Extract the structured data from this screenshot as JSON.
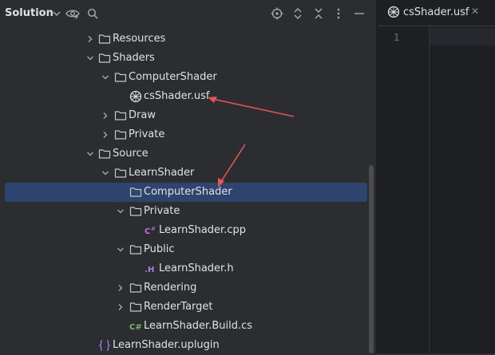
{
  "header": {
    "title": "Solution",
    "icons": [
      "chevron-down-icon",
      "eye-icon",
      "search-icon",
      "locate-icon",
      "expand-icon",
      "collapse-icon",
      "more-icon",
      "minimize-icon"
    ]
  },
  "tree": [
    {
      "label": "Resources",
      "icon": "folder",
      "expander": "collapsed"
    },
    {
      "label": "Shaders",
      "icon": "folder",
      "expander": "expanded"
    },
    {
      "label": "ComputerShader",
      "icon": "folder",
      "expander": "expanded"
    },
    {
      "label": "csShader.usf",
      "icon": "shader-file",
      "expander": "none"
    },
    {
      "label": "Draw",
      "icon": "folder",
      "expander": "collapsed"
    },
    {
      "label": "Private",
      "icon": "folder",
      "expander": "collapsed"
    },
    {
      "label": "Source",
      "icon": "folder",
      "expander": "expanded"
    },
    {
      "label": "LearnShader",
      "icon": "folder",
      "expander": "expanded"
    },
    {
      "label": "ComputerShader",
      "icon": "folder",
      "expander": "none",
      "selected": true
    },
    {
      "label": "Private",
      "icon": "folder",
      "expander": "expanded"
    },
    {
      "label": "LearnShader.cpp",
      "icon": "cpp-file",
      "expander": "none"
    },
    {
      "label": "Public",
      "icon": "folder",
      "expander": "expanded"
    },
    {
      "label": "LearnShader.h",
      "icon": "header-file",
      "expander": "none"
    },
    {
      "label": "Rendering",
      "icon": "folder",
      "expander": "collapsed"
    },
    {
      "label": "RenderTarget",
      "icon": "folder",
      "expander": "collapsed"
    },
    {
      "label": "LearnShader.Build.cs",
      "icon": "csharp-file",
      "expander": "none"
    },
    {
      "label": "LearnShader.uplugin",
      "icon": "uplugin-file",
      "expander": "none"
    }
  ],
  "editor": {
    "tab_label": "csShader.usf",
    "line_number": "1"
  },
  "colors": {
    "accent_arrow": "#e0545a",
    "selection": "#2e436e",
    "cpp_purple": "#b57bd4",
    "csharp_green": "#6cb86a"
  }
}
